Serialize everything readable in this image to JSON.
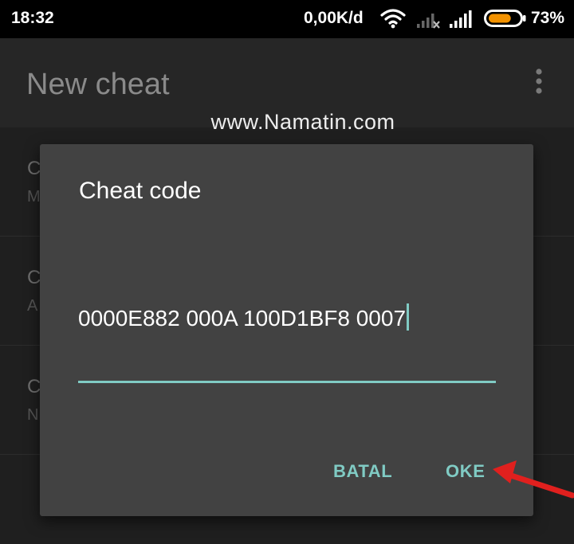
{
  "status_bar": {
    "time": "18:32",
    "net_speed": "0,00K/d",
    "battery_percent": "73%",
    "battery_level": 0.73,
    "icons": [
      "wifi-icon",
      "signal-off-icon",
      "signal-icon",
      "battery-icon"
    ]
  },
  "toolbar": {
    "title": "New cheat",
    "menu_icon": "overflow-menu-icon"
  },
  "list": {
    "rows": [
      {
        "title": "C",
        "subtitle": "M"
      },
      {
        "title": "C",
        "subtitle": "A"
      },
      {
        "title": "C",
        "subtitle": "N"
      }
    ]
  },
  "watermark": "www.Namatin.com",
  "dialog": {
    "title": "Cheat code",
    "input_value": "0000E882 000A 100D1BF8 0007",
    "cancel_label": "BATAL",
    "ok_label": "OKE"
  },
  "colors": {
    "accent": "#80cbc4",
    "dialog_bg": "#424242",
    "annotation_arrow": "#e0201e"
  }
}
